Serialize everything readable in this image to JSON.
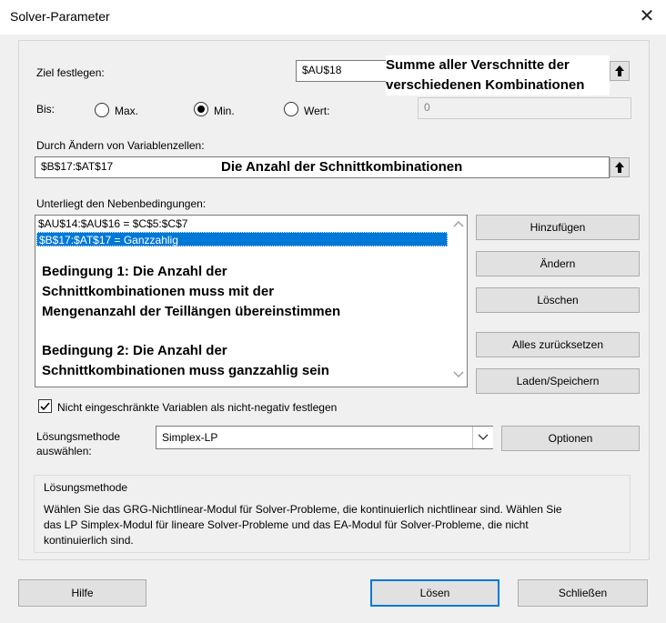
{
  "window": {
    "title": "Solver-Parameter",
    "close_glyph": "✕"
  },
  "objective": {
    "label": "Ziel festlegen:",
    "value": "$AU$18",
    "annotation_line1": "Summe aller Verschnitte der",
    "annotation_line2": "verschiedenen Kombinationen"
  },
  "to": {
    "label": "Bis:",
    "options": [
      {
        "label": "Max.",
        "selected": false
      },
      {
        "label": "Min.",
        "selected": true
      },
      {
        "label": "Wert:",
        "selected": false
      }
    ],
    "value": "0"
  },
  "variables": {
    "label": "Durch Ändern von Variablenzellen:",
    "value": "$B$17:$AT$17",
    "annotation": "Die Anzahl der Schnittkombinationen"
  },
  "constraints": {
    "label": "Unterliegt den Nebenbedingungen:",
    "items": [
      "$AU$14:$AU$16 = $C$5:$C$7",
      "$B$17:$AT$17 = Ganzzahlig"
    ],
    "selected_index": 1,
    "annotation1_line1": "Bedingung 1: Die Anzahl der",
    "annotation1_line2": "Schnittkombinationen muss mit der",
    "annotation1_line3": "Mengenanzahl der Teillängen übereinstimmen",
    "annotation2_line1": "Bedingung 2: Die Anzahl der",
    "annotation2_line2": "Schnittkombinationen muss ganzzahlig sein"
  },
  "side_buttons": {
    "add": "Hinzufügen",
    "change": "Ändern",
    "delete": "Löschen",
    "reset_all": "Alles zurücksetzen",
    "load_save": "Laden/Speichern"
  },
  "nonneg": {
    "label": "Nicht eingeschränkte Variablen als nicht-negativ festlegen",
    "checked": true
  },
  "method": {
    "label_line1": "Lösungsmethode",
    "label_line2": "auswählen:",
    "selected": "Simplex-LP",
    "options_button": "Optionen"
  },
  "info": {
    "title": "Lösungsmethode",
    "line1": "Wählen Sie das GRG-Nichtlinear-Modul für Solver-Probleme, die kontinuierlich nichtlinear sind. Wählen Sie",
    "line2": "das LP Simplex-Modul für lineare Solver-Probleme und das EA-Modul für Solver-Probleme, die nicht",
    "line3": "kontinuierlich sind."
  },
  "footer": {
    "help": "Hilfe",
    "solve": "Lösen",
    "close": "Schließen"
  },
  "colors": {
    "selection": "#0078d7",
    "default_border": "#0078d7"
  }
}
